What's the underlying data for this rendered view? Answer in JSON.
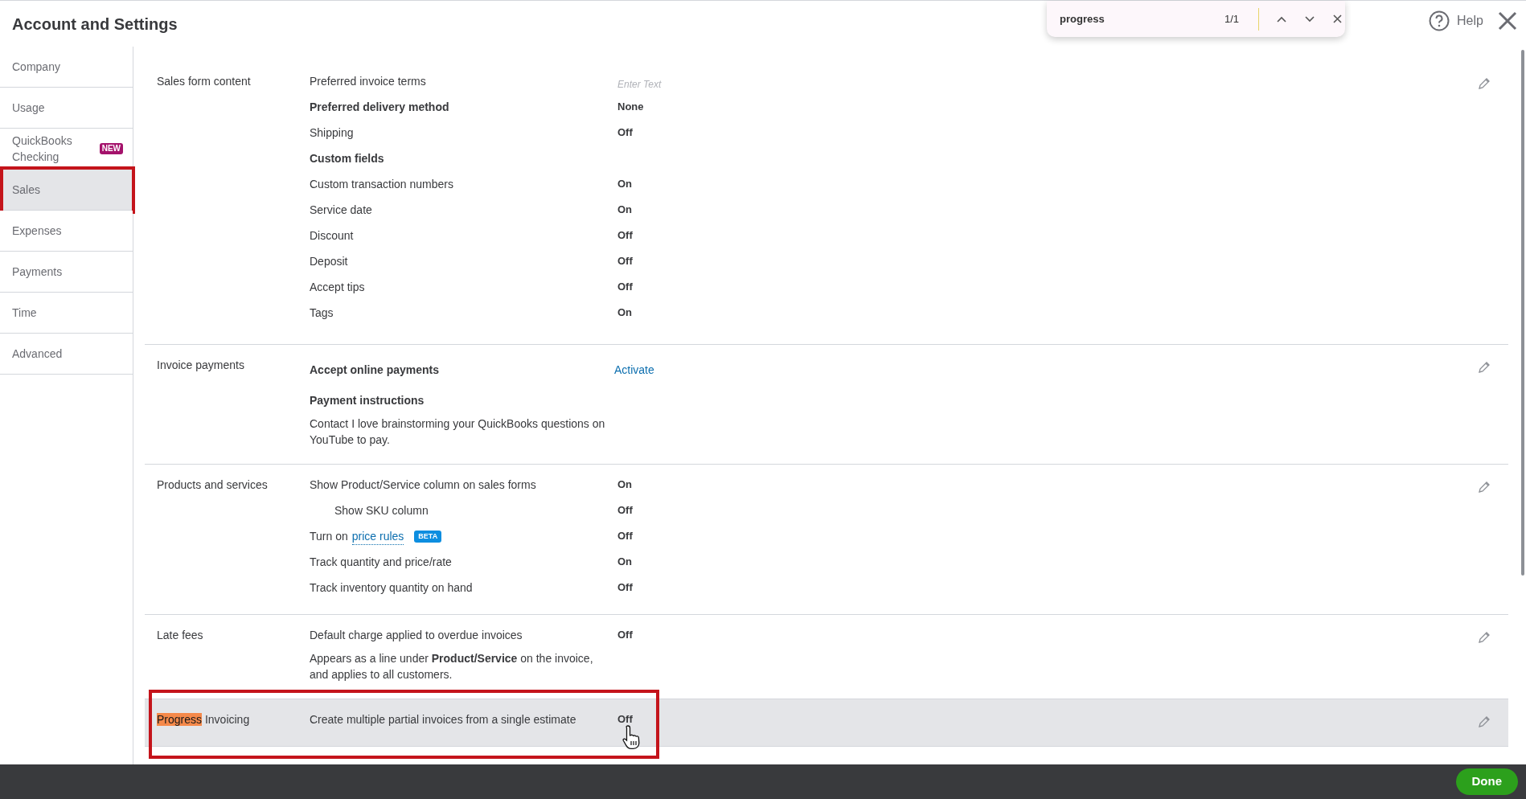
{
  "header": {
    "title": "Account and Settings",
    "help": "Help"
  },
  "find_bar": {
    "query": "progress",
    "count": "1/1"
  },
  "sidebar": {
    "items": [
      {
        "label": "Company",
        "selected": false,
        "annotated": false
      },
      {
        "label": "Usage",
        "selected": false,
        "annotated": false
      },
      {
        "label": "QuickBooks Checking",
        "badge": "NEW",
        "selected": false,
        "annotated": false
      },
      {
        "label": "Sales",
        "selected": true,
        "annotated": true
      },
      {
        "label": "Expenses",
        "selected": false,
        "annotated": false
      },
      {
        "label": "Payments",
        "selected": false,
        "annotated": false
      },
      {
        "label": "Time",
        "selected": false,
        "annotated": false
      },
      {
        "label": "Advanced",
        "selected": false,
        "annotated": false
      }
    ]
  },
  "sections": [
    {
      "title_parts": [
        {
          "text": "Sales form content",
          "match": false
        }
      ],
      "highlighted": false,
      "annotated": false,
      "rows": [
        {
          "kind": "field",
          "label": "Preferred invoice terms",
          "placeholder": "Enter Text"
        },
        {
          "kind": "setting",
          "label": "Preferred delivery method",
          "bold": true,
          "indented": false,
          "value": "None"
        },
        {
          "kind": "setting",
          "label": "Shipping",
          "bold": false,
          "indented": false,
          "value": "Off"
        },
        {
          "kind": "heading",
          "label": "Custom fields"
        },
        {
          "kind": "setting",
          "label": "Custom transaction numbers",
          "bold": false,
          "indented": false,
          "value": "On"
        },
        {
          "kind": "setting",
          "label": "Service date",
          "bold": false,
          "indented": false,
          "value": "On"
        },
        {
          "kind": "setting",
          "label": "Discount",
          "bold": false,
          "indented": false,
          "value": "Off"
        },
        {
          "kind": "setting",
          "label": "Deposit",
          "bold": false,
          "indented": false,
          "value": "Off"
        },
        {
          "kind": "setting",
          "label": "Accept tips",
          "bold": false,
          "indented": false,
          "value": "Off"
        },
        {
          "kind": "setting",
          "label": "Tags",
          "bold": false,
          "indented": false,
          "value": "On"
        }
      ]
    },
    {
      "title_parts": [
        {
          "text": "Invoice payments",
          "match": false
        }
      ],
      "highlighted": false,
      "annotated": false,
      "rows": [
        {
          "kind": "action",
          "label": "Accept online payments",
          "link": "Activate"
        },
        {
          "kind": "heading",
          "label": "Payment instructions"
        },
        {
          "kind": "note",
          "text": "Contact I love brainstorming your QuickBooks questions on YouTube to pay."
        }
      ]
    },
    {
      "title_parts": [
        {
          "text": "Products and services",
          "match": false
        }
      ],
      "highlighted": false,
      "annotated": false,
      "rows": [
        {
          "kind": "setting",
          "label": "Show Product/Service column on sales forms",
          "bold": false,
          "indented": false,
          "value": "On"
        },
        {
          "kind": "setting",
          "label": "Show SKU column",
          "bold": false,
          "indented": true,
          "value": "Off"
        },
        {
          "kind": "link_setting",
          "prefix": "Turn on",
          "link": "price rules",
          "badge": "BETA",
          "value": "Off"
        },
        {
          "kind": "setting",
          "label": "Track quantity and price/rate",
          "bold": false,
          "indented": false,
          "value": "On"
        },
        {
          "kind": "setting",
          "label": "Track inventory quantity on hand",
          "bold": false,
          "indented": false,
          "value": "Off"
        }
      ]
    },
    {
      "title_parts": [
        {
          "text": "Late fees",
          "match": false
        }
      ],
      "highlighted": false,
      "annotated": false,
      "rows": [
        {
          "kind": "setting",
          "label": "Default charge applied to overdue invoices",
          "bold": false,
          "indented": false,
          "value": "Off"
        },
        {
          "kind": "note",
          "text": "Appears as a line under **Product/Service** on the invoice, and applies to all customers."
        }
      ]
    },
    {
      "title_parts": [
        {
          "text": "Progress",
          "match": true
        },
        {
          "text": " Invoicing",
          "match": false
        }
      ],
      "highlighted": true,
      "annotated": true,
      "cursor": true,
      "rows": [
        {
          "kind": "setting",
          "label": "Create multiple partial invoices from a single estimate",
          "bold": false,
          "indented": false,
          "value": "Off"
        }
      ]
    }
  ],
  "footer": {
    "done": "Done"
  }
}
